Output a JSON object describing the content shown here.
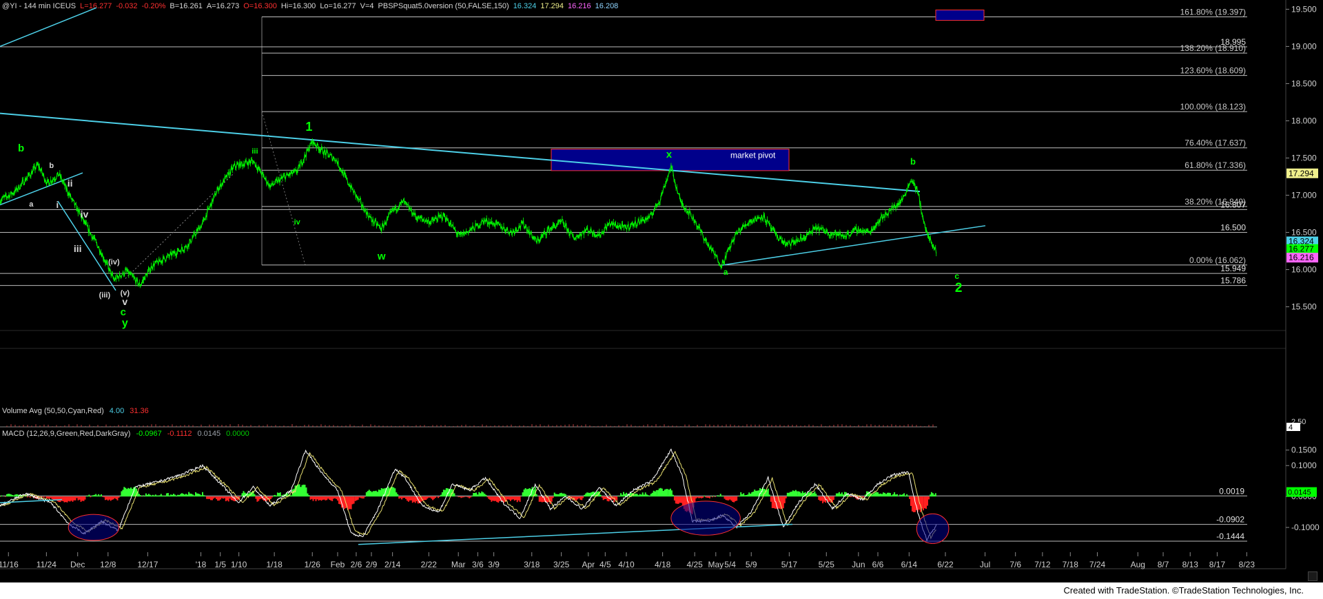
{
  "header": {
    "symbol": "@YI - 144 min ICEUS",
    "quote": [
      {
        "text": "L=16.277",
        "color": "#ff3030"
      },
      {
        "text": "-0.032",
        "color": "#ff3030"
      },
      {
        "text": "-0.20%",
        "color": "#ff3030"
      },
      {
        "text": "B=16.261",
        "color": "#d8d8d8"
      },
      {
        "text": "A=16.273",
        "color": "#d8d8d8"
      },
      {
        "text": "O=16.300",
        "color": "#ff3030"
      },
      {
        "text": "Hi=16.300",
        "color": "#d8d8d8"
      },
      {
        "text": "Lo=16.277",
        "color": "#d8d8d8"
      },
      {
        "text": "V=4",
        "color": "#d8d8d8"
      }
    ],
    "indicator": "PBSPSquat5.0version (50,FALSE,150)",
    "indicator_values": [
      {
        "text": "16.324",
        "color": "#4dd0e8"
      },
      {
        "text": "17.294",
        "color": "#f0f08c"
      },
      {
        "text": "16.216",
        "color": "#ff66ff"
      },
      {
        "text": "16.208",
        "color": "#8fd4ff"
      }
    ]
  },
  "volume_panel": {
    "label": "Volume Avg (50,50,Cyan,Red)",
    "values": [
      {
        "text": "4.00",
        "color": "#4dd0e8"
      },
      {
        "text": "31.36",
        "color": "#ff3030"
      }
    ],
    "axis_labels": [
      "2.50",
      "4"
    ]
  },
  "macd_panel": {
    "label": "MACD (12,26,9,Green,Red,DarkGray)",
    "values": [
      {
        "text": "-0.0967",
        "color": "#00ff00"
      },
      {
        "text": "-0.1112",
        "color": "#ff3030"
      },
      {
        "text": "0.0145",
        "color": "#9aa0a8"
      },
      {
        "text": "0.0000",
        "color": "#00c800"
      }
    ]
  },
  "footer": {
    "text": "Created with TradeStation. ©TradeStation Technologies, Inc."
  },
  "colors": {
    "price": "#00ff00",
    "trend": "#4dd0e8",
    "fib": "#c0c0c0",
    "box": "#00008b",
    "wave": "#00ff00"
  },
  "chart_data": [
    {
      "type": "line",
      "panel": "price",
      "ylim": [
        15.2,
        19.55
      ],
      "y_ticks": [
        15.5,
        16.0,
        16.5,
        17.0,
        17.5,
        18.0,
        18.5,
        19.0,
        19.5
      ],
      "y_tick_labels": [
        "15.500",
        "16.000",
        "16.500",
        "17.000",
        "17.500",
        "18.000",
        "18.500",
        "19.000",
        "19.500"
      ],
      "x_labels": [
        "11/16",
        "11/24",
        "Dec",
        "12/8",
        "12/17",
        "'18",
        "1/5",
        "1/10",
        "1/18",
        "1/26",
        "Feb",
        "2/6",
        "2/9",
        "2/14",
        "2/22",
        "Mar",
        "3/6",
        "3/9",
        "3/18",
        "3/25",
        "Apr",
        "4/5",
        "4/10",
        "4/18",
        "4/25",
        "May",
        "5/4",
        "5/9",
        "5/17",
        "5/25",
        "Jun",
        "6/6",
        "6/14",
        "6/22",
        "Jul",
        "7/6",
        "7/12",
        "7/18",
        "7/24",
        "Aug",
        "8/7",
        "8/13",
        "8/17",
        "8/23"
      ],
      "x_positions": [
        10,
        55,
        92,
        128,
        175,
        238,
        261,
        283,
        325,
        370,
        400,
        422,
        440,
        465,
        508,
        543,
        566,
        585,
        630,
        665,
        697,
        717,
        742,
        785,
        823,
        848,
        865,
        890,
        935,
        979,
        1017,
        1040,
        1077,
        1120,
        1167,
        1203,
        1235,
        1268,
        1300,
        1348,
        1378,
        1410,
        1442,
        1477
      ],
      "fib_levels": [
        {
          "value": 19.397,
          "label": "161.80% (19.397)"
        },
        {
          "value": 18.91,
          "label": "138.20% (18.910)"
        },
        {
          "value": 18.609,
          "label": "123.60% (18.609)"
        },
        {
          "value": 18.123,
          "label": "100.00% (18.123)"
        },
        {
          "value": 17.637,
          "label": "76.40% (17.637)"
        },
        {
          "value": 17.336,
          "label": "61.80% (17.336)"
        },
        {
          "value": 16.849,
          "label": "38.20% (16.849)"
        },
        {
          "value": 16.062,
          "label": "0.00% (16.062)"
        }
      ],
      "horizontal_levels": [
        {
          "value": 18.995,
          "label": "18.995"
        },
        {
          "value": 16.807,
          "label": "16.807"
        },
        {
          "value": 16.5,
          "label": "16.500"
        },
        {
          "value": 15.949,
          "label": "15.949"
        },
        {
          "value": 15.786,
          "label": "15.786"
        }
      ],
      "price_markers": [
        {
          "value": 17.294,
          "label": "17.294",
          "color": "#f0f08c",
          "text": "#000000"
        },
        {
          "value": 16.324,
          "label": "16.324",
          "color": "#4dd0e8",
          "text": "#000000"
        },
        {
          "value": 16.277,
          "label": "16.277",
          "color": "#00ff00",
          "text": "#000000"
        },
        {
          "value": 16.216,
          "label": "16.216",
          "color": "#ff66ff",
          "text": "#000000"
        }
      ],
      "pivots": [
        [
          0,
          16.93
        ],
        [
          18,
          17.05
        ],
        [
          34,
          17.26
        ],
        [
          45,
          17.41
        ],
        [
          56,
          17.16
        ],
        [
          70,
          17.28
        ],
        [
          86,
          16.92
        ],
        [
          104,
          16.55
        ],
        [
          118,
          16.28
        ],
        [
          135,
          15.86
        ],
        [
          150,
          15.98
        ],
        [
          166,
          15.79
        ],
        [
          180,
          16.05
        ],
        [
          200,
          16.18
        ],
        [
          222,
          16.32
        ],
        [
          240,
          16.62
        ],
        [
          258,
          17.08
        ],
        [
          278,
          17.39
        ],
        [
          300,
          17.46
        ],
        [
          320,
          17.12
        ],
        [
          338,
          17.25
        ],
        [
          352,
          17.32
        ],
        [
          370,
          17.72
        ],
        [
          386,
          17.56
        ],
        [
          398,
          17.48
        ],
        [
          412,
          17.18
        ],
        [
          424,
          16.95
        ],
        [
          440,
          16.67
        ],
        [
          452,
          16.55
        ],
        [
          466,
          16.8
        ],
        [
          478,
          16.91
        ],
        [
          494,
          16.7
        ],
        [
          510,
          16.64
        ],
        [
          526,
          16.73
        ],
        [
          544,
          16.45
        ],
        [
          560,
          16.55
        ],
        [
          574,
          16.66
        ],
        [
          590,
          16.6
        ],
        [
          606,
          16.5
        ],
        [
          620,
          16.62
        ],
        [
          636,
          16.37
        ],
        [
          650,
          16.54
        ],
        [
          666,
          16.64
        ],
        [
          680,
          16.42
        ],
        [
          696,
          16.54
        ],
        [
          710,
          16.46
        ],
        [
          722,
          16.62
        ],
        [
          740,
          16.56
        ],
        [
          756,
          16.64
        ],
        [
          770,
          16.7
        ],
        [
          782,
          16.95
        ],
        [
          795,
          17.38
        ],
        [
          806,
          16.92
        ],
        [
          822,
          16.68
        ],
        [
          838,
          16.35
        ],
        [
          855,
          16.06
        ],
        [
          872,
          16.48
        ],
        [
          888,
          16.65
        ],
        [
          904,
          16.72
        ],
        [
          918,
          16.48
        ],
        [
          932,
          16.33
        ],
        [
          950,
          16.41
        ],
        [
          968,
          16.56
        ],
        [
          984,
          16.49
        ],
        [
          1000,
          16.45
        ],
        [
          1016,
          16.54
        ],
        [
          1030,
          16.5
        ],
        [
          1044,
          16.69
        ],
        [
          1058,
          16.83
        ],
        [
          1068,
          16.92
        ],
        [
          1080,
          17.22
        ],
        [
          1088,
          17.02
        ],
        [
          1095,
          16.6
        ],
        [
          1104,
          16.32
        ],
        [
          1110,
          16.24
        ]
      ],
      "annotations": [
        {
          "text": "b",
          "x": 25,
          "y": 220,
          "color": "#00ff00",
          "size": 15
        },
        {
          "text": "a",
          "x": 37,
          "y": 300,
          "color": "#d8d8d8",
          "size": 11
        },
        {
          "text": "b",
          "x": 61,
          "y": 244,
          "color": "#d8d8d8",
          "size": 11
        },
        {
          "text": "i",
          "x": 68,
          "y": 302,
          "color": "#d8d8d8",
          "size": 13
        },
        {
          "text": "ii",
          "x": 83,
          "y": 271,
          "color": "#d8d8d8",
          "size": 14
        },
        {
          "text": "iii",
          "x": 92,
          "y": 366,
          "color": "#d8d8d8",
          "size": 14
        },
        {
          "text": "iv",
          "x": 100,
          "y": 316,
          "color": "#d8d8d8",
          "size": 14
        },
        {
          "text": "(iv)",
          "x": 135,
          "y": 384,
          "color": "#d8d8d8",
          "size": 11
        },
        {
          "text": "(iii)",
          "x": 124,
          "y": 432,
          "color": "#d8d8d8",
          "size": 11
        },
        {
          "text": "(v)",
          "x": 148,
          "y": 429,
          "color": "#d8d8d8",
          "size": 11
        },
        {
          "text": "v",
          "x": 148,
          "y": 443,
          "color": "#d8d8d8",
          "size": 14
        },
        {
          "text": "c",
          "x": 146,
          "y": 458,
          "color": "#00ff00",
          "size": 15
        },
        {
          "text": "y",
          "x": 148,
          "y": 474,
          "color": "#00ff00",
          "size": 16
        },
        {
          "text": "iii",
          "x": 302,
          "y": 223,
          "color": "#00ff00",
          "size": 11
        },
        {
          "text": "iv",
          "x": 352,
          "y": 326,
          "color": "#00ff00",
          "size": 11
        },
        {
          "text": "1",
          "x": 366,
          "y": 190,
          "color": "#00ff00",
          "size": 18
        },
        {
          "text": "w",
          "x": 452,
          "y": 377,
          "color": "#00ff00",
          "size": 15
        },
        {
          "text": "x",
          "x": 791,
          "y": 229,
          "color": "#00ff00",
          "size": 15
        },
        {
          "text": "a",
          "x": 858,
          "y": 399,
          "color": "#00ff00",
          "size": 12
        },
        {
          "text": "b",
          "x": 1080,
          "y": 239,
          "color": "#00ff00",
          "size": 13
        },
        {
          "text": "c",
          "x": 1132,
          "y": 405,
          "color": "#00ff00",
          "size": 12
        },
        {
          "text": "2",
          "x": 1134,
          "y": 424,
          "color": "#00ff00",
          "size": 19
        }
      ],
      "pivot_box": {
        "label": "market pivot",
        "y_top": 17.62,
        "y_bottom": 17.33,
        "x_left": 800,
        "x_right": 1145
      },
      "extension_box": {
        "y_top": 19.49,
        "y_bottom": 19.35,
        "x_left": 1358,
        "x_right": 1428
      }
    },
    {
      "type": "bar",
      "panel": "macd",
      "ylim": [
        -0.18,
        0.185
      ],
      "y_ticks": [
        -0.1,
        0.0,
        0.1,
        0.15
      ],
      "y_tick_labels": [
        "-0.1000",
        "0.0000",
        "0.1000",
        "0.1500"
      ],
      "levels": [
        {
          "value": 0.0019,
          "label": "0.0019"
        },
        {
          "value": -0.0902,
          "label": "-0.0902"
        },
        {
          "value": -0.1444,
          "label": "-0.1444"
        }
      ],
      "current_value": {
        "value": 0.0145,
        "label": "0.0145"
      },
      "macd_pivots": [
        [
          0,
          -0.03
        ],
        [
          30,
          0.01
        ],
        [
          60,
          -0.02
        ],
        [
          82,
          -0.09
        ],
        [
          100,
          -0.12
        ],
        [
          120,
          -0.08
        ],
        [
          140,
          -0.11
        ],
        [
          160,
          0.03
        ],
        [
          190,
          0.05
        ],
        [
          214,
          0.07
        ],
        [
          240,
          0.1
        ],
        [
          262,
          0.04
        ],
        [
          282,
          -0.02
        ],
        [
          300,
          0.03
        ],
        [
          320,
          -0.03
        ],
        [
          345,
          0.02
        ],
        [
          362,
          0.15
        ],
        [
          380,
          0.08
        ],
        [
          400,
          0.02
        ],
        [
          416,
          -0.12
        ],
        [
          430,
          -0.13
        ],
        [
          448,
          -0.04
        ],
        [
          468,
          0.09
        ],
        [
          480,
          0.06
        ],
        [
          500,
          -0.03
        ],
        [
          520,
          -0.05
        ],
        [
          536,
          0.04
        ],
        [
          556,
          0.02
        ],
        [
          575,
          0.06
        ],
        [
          596,
          -0.02
        ],
        [
          616,
          -0.07
        ],
        [
          634,
          0.04
        ],
        [
          652,
          -0.04
        ],
        [
          670,
          0.0
        ],
        [
          690,
          -0.04
        ],
        [
          710,
          0.03
        ],
        [
          730,
          -0.03
        ],
        [
          750,
          0.02
        ],
        [
          772,
          0.05
        ],
        [
          795,
          0.15
        ],
        [
          808,
          0.07
        ],
        [
          820,
          -0.08
        ],
        [
          840,
          -0.08
        ],
        [
          856,
          -0.06
        ],
        [
          872,
          -0.1
        ],
        [
          890,
          -0.05
        ],
        [
          910,
          0.06
        ],
        [
          928,
          -0.1
        ],
        [
          946,
          -0.02
        ],
        [
          966,
          0.04
        ],
        [
          986,
          -0.04
        ],
        [
          1004,
          0.01
        ],
        [
          1022,
          -0.01
        ],
        [
          1040,
          0.04
        ],
        [
          1058,
          0.07
        ],
        [
          1076,
          0.08
        ],
        [
          1088,
          -0.06
        ],
        [
          1098,
          -0.14
        ],
        [
          1110,
          -0.09
        ]
      ],
      "ellipses": [
        {
          "cx": 111,
          "cy": -0.1,
          "rx": 30,
          "ry": 0.042
        },
        {
          "cx": 836,
          "cy": -0.07,
          "rx": 41,
          "ry": 0.055
        },
        {
          "cx": 1105,
          "cy": -0.104,
          "rx": 19,
          "ry": 0.048
        }
      ]
    }
  ]
}
